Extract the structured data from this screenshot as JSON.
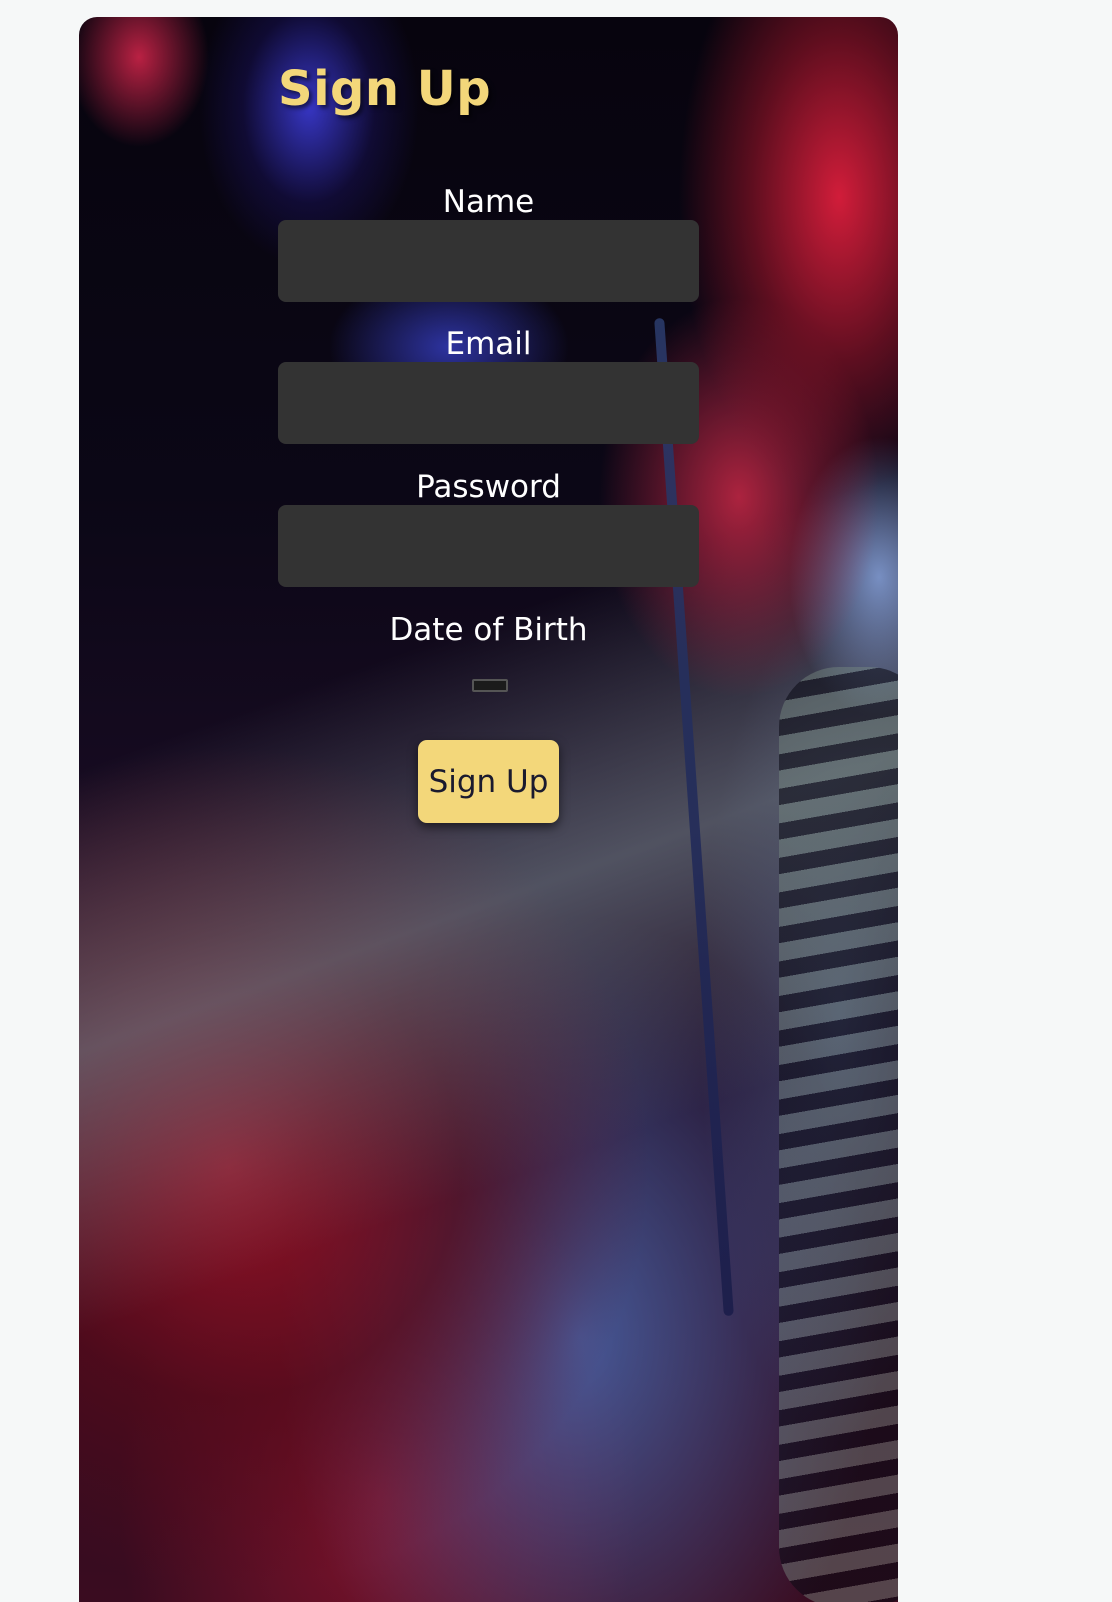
{
  "form": {
    "title": "Sign Up",
    "fields": {
      "name": {
        "label": "Name",
        "value": ""
      },
      "email": {
        "label": "Email",
        "value": ""
      },
      "password": {
        "label": "Password",
        "value": ""
      },
      "date_of_birth": {
        "label": "Date of Birth",
        "value": ""
      }
    },
    "submit_label": "Sign Up"
  },
  "colors": {
    "page_background": "#f6f8f8",
    "title": "#f3d77a",
    "input_background": "#333333",
    "button_background": "#f3d77a",
    "label_text": "#ffffff"
  }
}
